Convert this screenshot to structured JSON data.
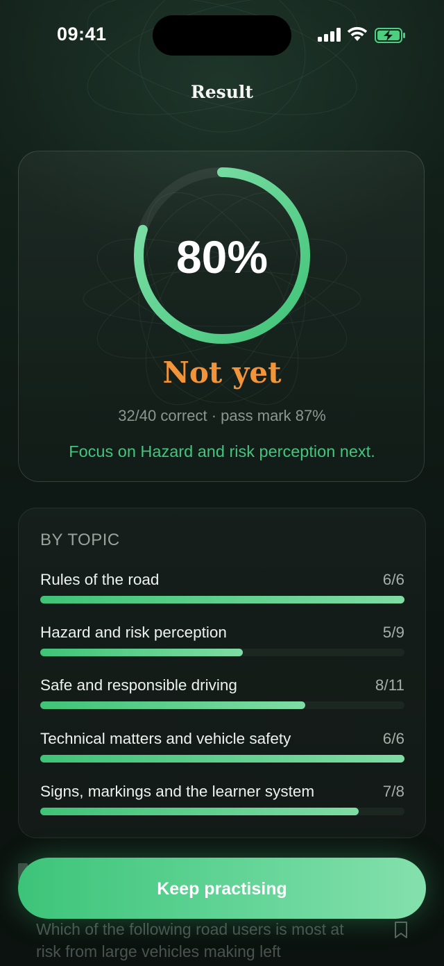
{
  "status_bar": {
    "time": "09:41"
  },
  "header": {
    "title": "Result"
  },
  "result": {
    "percent_label": "80%",
    "percent_value": 80,
    "verdict": "Not yet",
    "score_line": "32/40 correct · pass mark 87%",
    "advice": "Focus on Hazard and risk perception next."
  },
  "topics": {
    "heading": "BY TOPIC",
    "items": [
      {
        "label": "Rules of the road",
        "score": "6/6",
        "fraction": 1.0
      },
      {
        "label": "Hazard and risk perception",
        "score": "5/9",
        "fraction": 0.556
      },
      {
        "label": "Safe and responsible driving",
        "score": "8/11",
        "fraction": 0.727
      },
      {
        "label": "Technical matters and vehicle safety",
        "score": "6/6",
        "fraction": 1.0
      },
      {
        "label": "Signs, markings and the learner system",
        "score": "7/8",
        "fraction": 0.875
      }
    ]
  },
  "review": {
    "first_question": "Which of the following road users is most at risk from large vehicles making left"
  },
  "cta": {
    "label": "Keep practising"
  },
  "colors": {
    "accent": "#3fc377",
    "verdict": "#f2943a",
    "background": "#0f1a15"
  }
}
